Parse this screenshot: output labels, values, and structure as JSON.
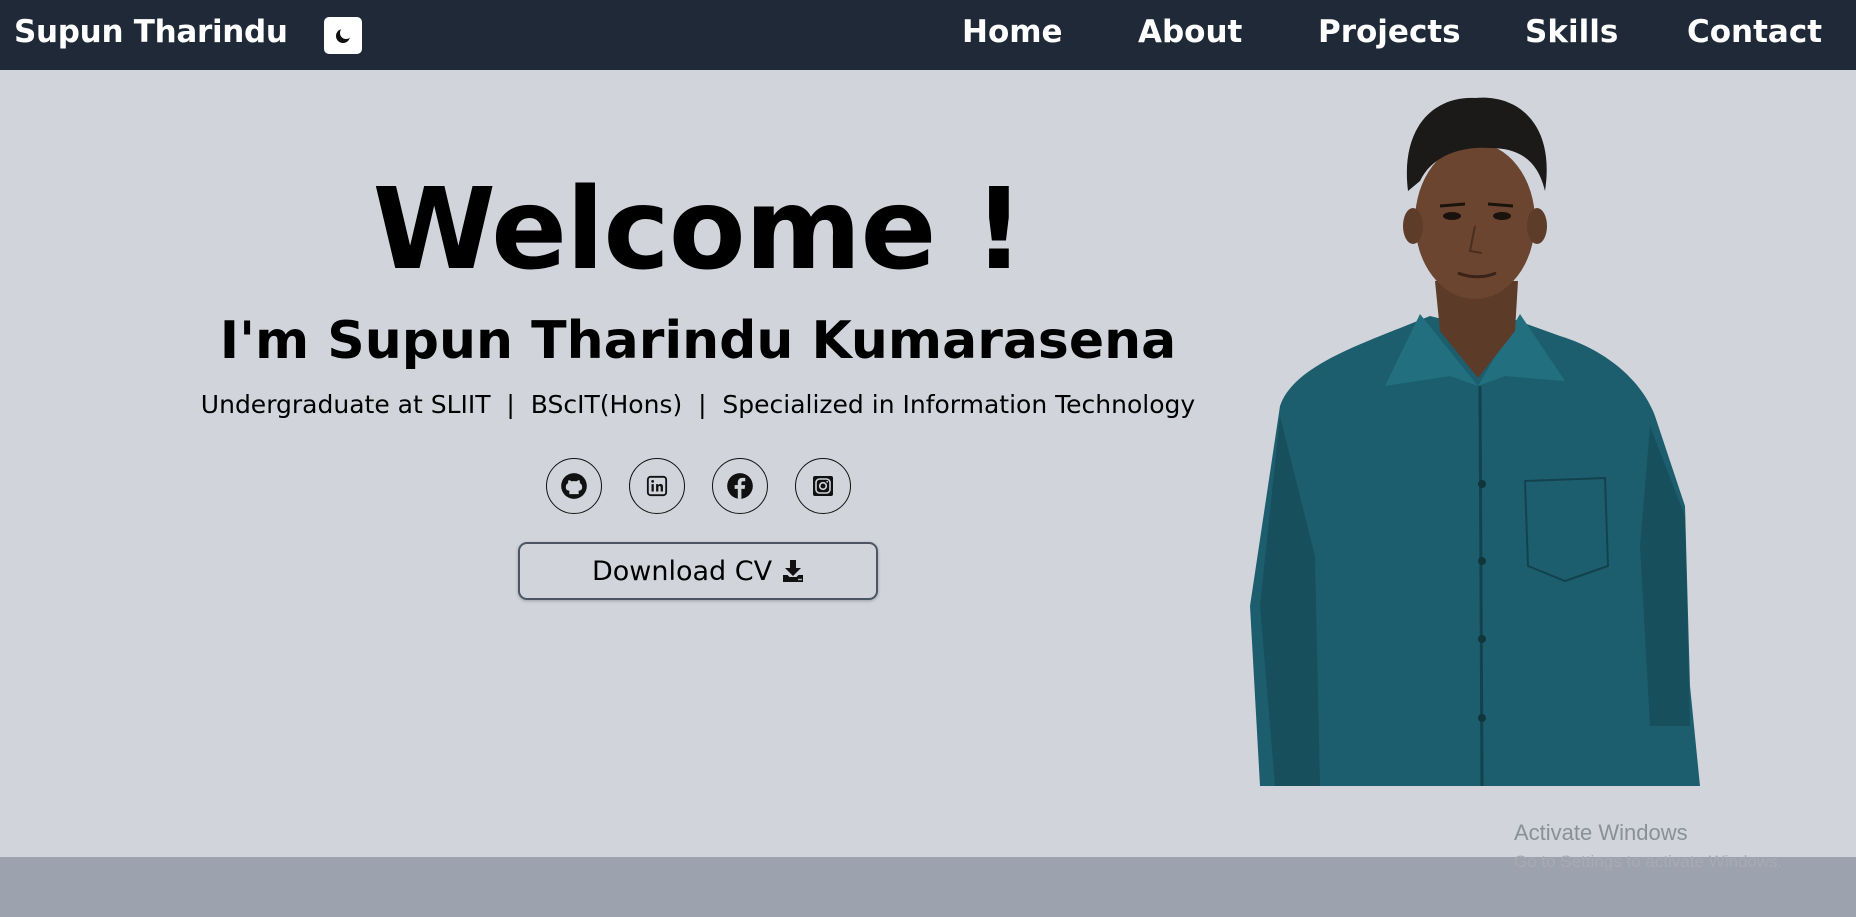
{
  "nav": {
    "brand": "Supun Tharindu",
    "theme_toggle_icon": "moon-icon",
    "links": [
      "Home",
      "About",
      "Projects",
      "Skills",
      "Contact"
    ]
  },
  "hero": {
    "welcome": "Welcome !",
    "name": "I'm Supun Tharindu Kumarasena",
    "tagline": "Undergraduate at SLIIT  |  BScIT(Hons)  |  Specialized in Information Technology",
    "socials": [
      "github-icon",
      "linkedin-icon",
      "facebook-icon",
      "instagram-icon"
    ],
    "cv_button": "Download CV",
    "cv_icon": "download-icon",
    "photo": "profile-photo"
  },
  "overlay": {
    "watermark": "Activate Windows",
    "watermark_sub": "Go to Settings to activate Windows."
  },
  "colors": {
    "navbar": "#1f2937",
    "hero_bg": "#d1d5db",
    "footer_band": "#9ca3af",
    "shirt": "#1d5e6e"
  }
}
